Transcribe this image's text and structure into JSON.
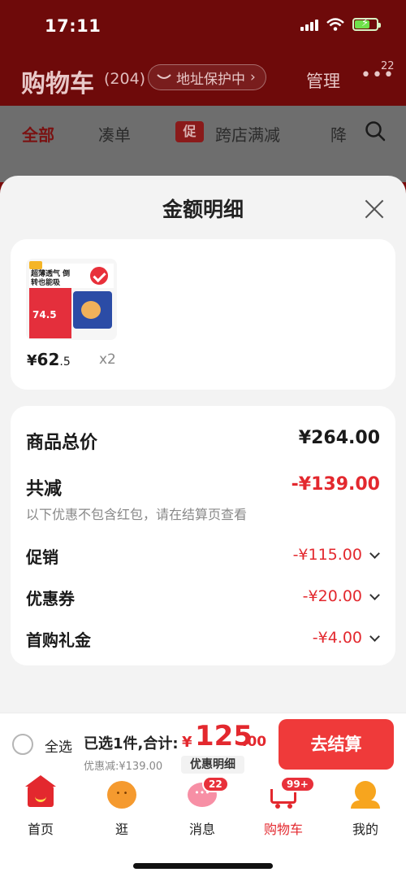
{
  "status_bar": {
    "time": "17:11"
  },
  "cart_header": {
    "title": "购物车",
    "count": "(204)",
    "address_chip": "地址保护中",
    "manage": "管理",
    "more_badge": "22"
  },
  "filter_bar": {
    "tabs": [
      "全部",
      "凑单",
      "跨店满减",
      "降"
    ],
    "promo_tag": "促"
  },
  "sheet": {
    "title": "金额明细",
    "product": {
      "thumb_text": "超薄透气 倒转也能吸",
      "thumb_price": "74.5",
      "price_symbol": "¥",
      "price_int": "62",
      "price_dec": ".5",
      "qty": "x2"
    },
    "details": {
      "total_label": "商品总价",
      "total_value": "¥264.00",
      "reduce_label": "共减",
      "reduce_value": "-¥139.00",
      "note": "以下优惠不包含红包，请在结算页查看",
      "rows": [
        {
          "label": "促销",
          "value": "-¥115.00"
        },
        {
          "label": "优惠券",
          "value": "-¥20.00"
        },
        {
          "label": "首购礼金",
          "value": "-¥4.00"
        }
      ]
    }
  },
  "checkout": {
    "select_all": "全选",
    "summary": "已选1件,合计:",
    "total_symbol": "¥",
    "total_int": "125",
    "total_dec": ".00",
    "discount_line": "优惠减:¥139.00",
    "detail_link": "优惠明细",
    "checkout_button": "去结算"
  },
  "tab_bar": {
    "tabs": [
      {
        "label": "首页",
        "icon": "home-icon"
      },
      {
        "label": "逛",
        "icon": "face-icon"
      },
      {
        "label": "消息",
        "icon": "message-icon",
        "badge": "22"
      },
      {
        "label": "购物车",
        "icon": "cart-icon",
        "badge": "99+"
      },
      {
        "label": "我的",
        "icon": "profile-icon"
      }
    ]
  },
  "colors": {
    "accent": "#e3282e",
    "header_bg": "#6e0a0a",
    "checkout_button": "#ef3a3a"
  }
}
